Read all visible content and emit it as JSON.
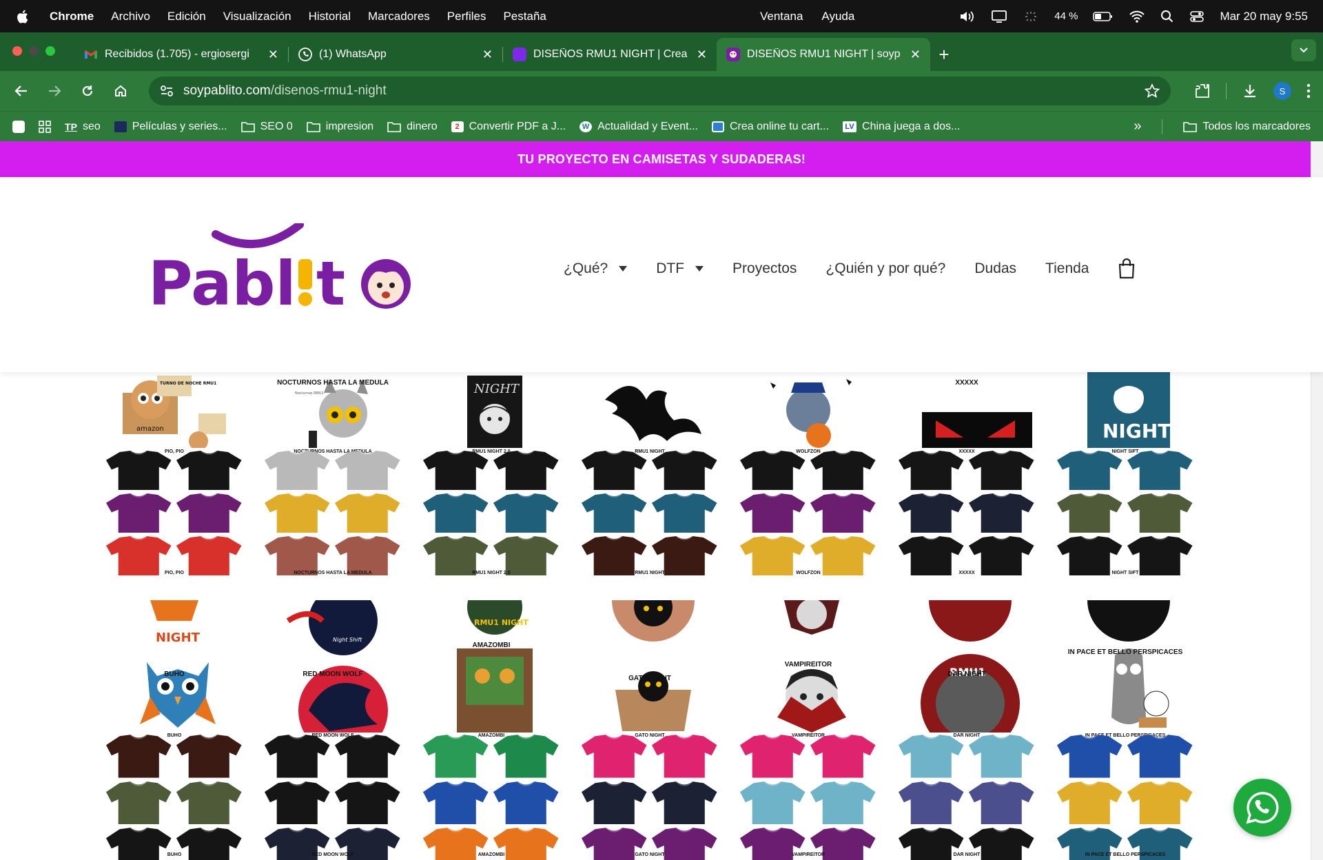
{
  "menubar": {
    "app": "Chrome",
    "items": [
      "Archivo",
      "Edición",
      "Visualización",
      "Historial",
      "Marcadores",
      "Perfiles",
      "Pestaña"
    ],
    "center": [
      "Ventana",
      "Ayuda"
    ],
    "battery": "44 %",
    "datetime": "Mar 20 may 9:55"
  },
  "tabs": [
    {
      "title": "Recibidos (1.705) - ergiosergi",
      "icon": "gmail-icon"
    },
    {
      "title": "(1) WhatsApp",
      "icon": "whatsapp-icon"
    },
    {
      "title": "DISEÑOS RMU1 NIGHT | Crea",
      "icon": "canva-icon"
    },
    {
      "title": "DISEÑOS RMU1 NIGHT | soyp",
      "icon": "site-icon"
    }
  ],
  "toolbar": {
    "url_host": "soypablito.com",
    "url_path": "/disenos-rmu1-night",
    "profile_initial": "S"
  },
  "bookmarks": [
    {
      "label": "seo",
      "icon": "TP"
    },
    {
      "label": "Películas y series...",
      "icon": "film"
    },
    {
      "label": "SEO 0",
      "icon": "folder"
    },
    {
      "label": "impresion",
      "icon": "folder"
    },
    {
      "label": "dinero",
      "icon": "folder"
    },
    {
      "label": "Convertir PDF a J...",
      "icon": "2"
    },
    {
      "label": "Actualidad y Event...",
      "icon": "W"
    },
    {
      "label": "Crea online tu cart...",
      "icon": "card"
    },
    {
      "label": "China juega a dos...",
      "icon": "LV"
    }
  ],
  "bookmarks_all": "Todos los marcadores",
  "site": {
    "promo": "TU PROYECTO EN CAMISETAS Y SUDADERAS!",
    "nav": [
      {
        "label": "¿Qué?",
        "dropdown": true
      },
      {
        "label": "DTF",
        "dropdown": true
      },
      {
        "label": "Proyectos",
        "dropdown": false
      },
      {
        "label": "¿Quién y por qué?",
        "dropdown": false
      },
      {
        "label": "Dudas",
        "dropdown": false
      },
      {
        "label": "Tienda",
        "dropdown": false
      }
    ]
  },
  "designs_row1": [
    {
      "name": "PIO, PIO",
      "colors": [
        "#151515",
        "#151515",
        "#6b1d6f",
        "#6b1d6f",
        "#d8302b",
        "#d8302b"
      ]
    },
    {
      "name": "NOCTURNOS HASTA LA MEDULA",
      "colors": [
        "#b9b9b9",
        "#b9b9b9",
        "#e0ad2a",
        "#e0ad2a",
        "#a0584a",
        "#a0584a"
      ]
    },
    {
      "name": "RMU1 NIGHT 2.0",
      "colors": [
        "#151515",
        "#151515",
        "#1f5f7a",
        "#1f5f7a",
        "#4e5a38",
        "#4e5a38"
      ]
    },
    {
      "name": "RMU1 NIGHT",
      "colors": [
        "#151515",
        "#151515",
        "#1f5f7a",
        "#1f5f7a",
        "#3a1a12",
        "#3a1a12"
      ]
    },
    {
      "name": "WOLFZON",
      "colors": [
        "#151515",
        "#151515",
        "#6b1d6f",
        "#6b1d6f",
        "#e0ad2a",
        "#e0ad2a"
      ]
    },
    {
      "name": "XXXXX",
      "colors": [
        "#151515",
        "#151515",
        "#1c2233",
        "#1c2233",
        "#151515",
        "#151515"
      ]
    },
    {
      "name": "NIGHT SIFT",
      "colors": [
        "#1f5f7a",
        "#1f5f7a",
        "#4e5a38",
        "#4e5a38",
        "#151515",
        "#151515"
      ]
    }
  ],
  "designs_row1_headers": [
    "",
    "NOCTURNOS HASTA LA MEDULA",
    "",
    "",
    "",
    "XXXXX",
    ""
  ],
  "designs_row2": [
    {
      "name": "BUHO",
      "colors": [
        "#3a1a12",
        "#3a1a12",
        "#4e5a38",
        "#4e5a38",
        "#151515",
        "#151515"
      ]
    },
    {
      "name": "RED MOON WOLF",
      "colors": [
        "#151515",
        "#151515",
        "#151515",
        "#151515",
        "#1c2233",
        "#1c2233"
      ]
    },
    {
      "name": "AMAZOMBI",
      "colors": [
        "#2a9a57",
        "#1d8a4c",
        "#1f4fa8",
        "#1f4fa8",
        "#e8731d",
        "#e8731d"
      ]
    },
    {
      "name": "GATO NIGHT",
      "colors": [
        "#e0236e",
        "#e0236e",
        "#1c2233",
        "#1c2233",
        "#6b1d6f",
        "#6b1d6f"
      ]
    },
    {
      "name": "VAMPIREITOR",
      "colors": [
        "#e0236e",
        "#e0236e",
        "#6fb3c9",
        "#6fb3c9",
        "#6b1d6f",
        "#6b1d6f"
      ]
    },
    {
      "name": "DAR NIGHT",
      "colors": [
        "#6fb3c9",
        "#6fb3c9",
        "#4c4f8e",
        "#4c4f8e",
        "#151515",
        "#151515"
      ]
    },
    {
      "name": "IN PACE ET BELLO PERSPICACES",
      "colors": [
        "#1f4fa8",
        "#1f4fa8",
        "#e0ad2a",
        "#e0ad2a",
        "#1f5f7a",
        "#1f5f7a"
      ]
    }
  ],
  "design_texts": {
    "night": "NIGHT",
    "night_shift": "NIGHT SHIFT",
    "night_script": "NIGHT",
    "rmu1": "RMU1",
    "amazombi_badge": "RMU1 NIGHT",
    "nocturnos_caption": "Nocturnos RMU1",
    "turno": "TURNO DE NOCHE RMU1",
    "amazon": "amazon",
    "nightshift_script": "Night Shift"
  },
  "colors": {
    "promo_bg": "#d41ef0",
    "browser_green": "#2e7a3b",
    "browser_dark_green": "#1d5e2c",
    "logo_purple": "#7b1fa2",
    "logo_yellow": "#f4b400",
    "whatsapp": "#1faa3e"
  }
}
